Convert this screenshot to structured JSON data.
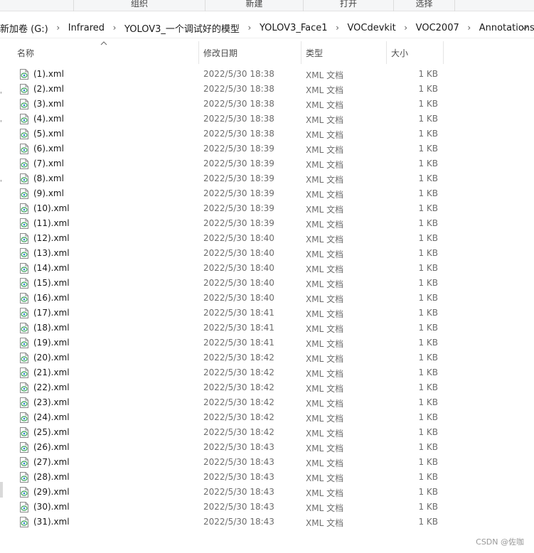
{
  "ribbon": {
    "groups": [
      "组织",
      "新建",
      "打开",
      "选择"
    ]
  },
  "address": {
    "crumbs": [
      "新加卷 (G:)",
      "Infrared",
      "YOLOV3_一个调试好的模型",
      "YOLOV3_Face1",
      "VOCdevkit",
      "VOC2007",
      "Annotations"
    ]
  },
  "columns": {
    "name": "名称",
    "date": "修改日期",
    "type": "类型",
    "size": "大小"
  },
  "files": [
    {
      "name": "(1).xml",
      "date": "2022/5/30 18:38",
      "type": "XML 文档",
      "size": "1 KB"
    },
    {
      "name": "(2).xml",
      "date": "2022/5/30 18:38",
      "type": "XML 文档",
      "size": "1 KB"
    },
    {
      "name": "(3).xml",
      "date": "2022/5/30 18:38",
      "type": "XML 文档",
      "size": "1 KB"
    },
    {
      "name": "(4).xml",
      "date": "2022/5/30 18:38",
      "type": "XML 文档",
      "size": "1 KB"
    },
    {
      "name": "(5).xml",
      "date": "2022/5/30 18:38",
      "type": "XML 文档",
      "size": "1 KB"
    },
    {
      "name": "(6).xml",
      "date": "2022/5/30 18:39",
      "type": "XML 文档",
      "size": "1 KB"
    },
    {
      "name": "(7).xml",
      "date": "2022/5/30 18:39",
      "type": "XML 文档",
      "size": "1 KB"
    },
    {
      "name": "(8).xml",
      "date": "2022/5/30 18:39",
      "type": "XML 文档",
      "size": "1 KB"
    },
    {
      "name": "(9).xml",
      "date": "2022/5/30 18:39",
      "type": "XML 文档",
      "size": "1 KB"
    },
    {
      "name": "(10).xml",
      "date": "2022/5/30 18:39",
      "type": "XML 文档",
      "size": "1 KB"
    },
    {
      "name": "(11).xml",
      "date": "2022/5/30 18:39",
      "type": "XML 文档",
      "size": "1 KB"
    },
    {
      "name": "(12).xml",
      "date": "2022/5/30 18:40",
      "type": "XML 文档",
      "size": "1 KB"
    },
    {
      "name": "(13).xml",
      "date": "2022/5/30 18:40",
      "type": "XML 文档",
      "size": "1 KB"
    },
    {
      "name": "(14).xml",
      "date": "2022/5/30 18:40",
      "type": "XML 文档",
      "size": "1 KB"
    },
    {
      "name": "(15).xml",
      "date": "2022/5/30 18:40",
      "type": "XML 文档",
      "size": "1 KB"
    },
    {
      "name": "(16).xml",
      "date": "2022/5/30 18:40",
      "type": "XML 文档",
      "size": "1 KB"
    },
    {
      "name": "(17).xml",
      "date": "2022/5/30 18:41",
      "type": "XML 文档",
      "size": "1 KB"
    },
    {
      "name": "(18).xml",
      "date": "2022/5/30 18:41",
      "type": "XML 文档",
      "size": "1 KB"
    },
    {
      "name": "(19).xml",
      "date": "2022/5/30 18:41",
      "type": "XML 文档",
      "size": "1 KB"
    },
    {
      "name": "(20).xml",
      "date": "2022/5/30 18:42",
      "type": "XML 文档",
      "size": "1 KB"
    },
    {
      "name": "(21).xml",
      "date": "2022/5/30 18:42",
      "type": "XML 文档",
      "size": "1 KB"
    },
    {
      "name": "(22).xml",
      "date": "2022/5/30 18:42",
      "type": "XML 文档",
      "size": "1 KB"
    },
    {
      "name": "(23).xml",
      "date": "2022/5/30 18:42",
      "type": "XML 文档",
      "size": "1 KB"
    },
    {
      "name": "(24).xml",
      "date": "2022/5/30 18:42",
      "type": "XML 文档",
      "size": "1 KB"
    },
    {
      "name": "(25).xml",
      "date": "2022/5/30 18:42",
      "type": "XML 文档",
      "size": "1 KB"
    },
    {
      "name": "(26).xml",
      "date": "2022/5/30 18:43",
      "type": "XML 文档",
      "size": "1 KB"
    },
    {
      "name": "(27).xml",
      "date": "2022/5/30 18:43",
      "type": "XML 文档",
      "size": "1 KB"
    },
    {
      "name": "(28).xml",
      "date": "2022/5/30 18:43",
      "type": "XML 文档",
      "size": "1 KB"
    },
    {
      "name": "(29).xml",
      "date": "2022/5/30 18:43",
      "type": "XML 文档",
      "size": "1 KB"
    },
    {
      "name": "(30).xml",
      "date": "2022/5/30 18:43",
      "type": "XML 文档",
      "size": "1 KB"
    },
    {
      "name": "(31).xml",
      "date": "2022/5/30 18:43",
      "type": "XML 文档",
      "size": "1 KB"
    }
  ],
  "watermark": "CSDN @佐咖"
}
